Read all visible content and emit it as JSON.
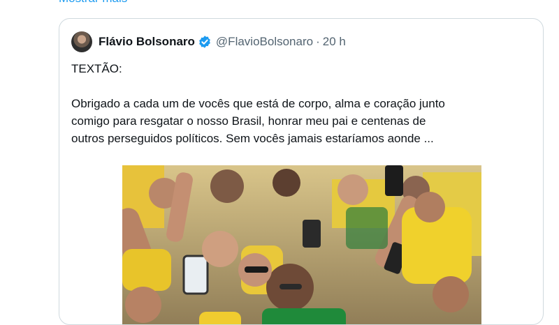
{
  "show_more": "Mostrar mais",
  "quoted_tweet": {
    "author_name": "Flávio Bolsonaro",
    "author_handle": "@FlavioBolsonaro",
    "separator": "·",
    "timestamp": "20 h",
    "verified": true,
    "text": "TEXTÃO:\n\nObrigado a cada um de vocês que está de corpo, alma e coração junto\ncomigo para resgatar o nosso Brasil, honrar meu pai e centenas de\noutros perseguidos políticos. Sem vocês jamais estaríamos aonde ...",
    "accent_color": "#1d9bf0",
    "media": {
      "type": "photo"
    }
  }
}
